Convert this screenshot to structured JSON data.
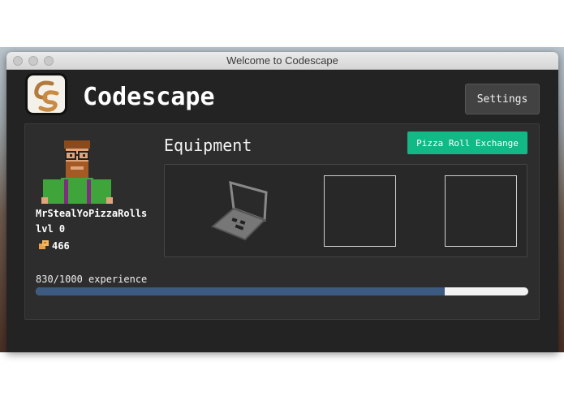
{
  "window": {
    "title": "Welcome to Codescape"
  },
  "header": {
    "app_name": "Codescape",
    "settings_label": "Settings"
  },
  "player": {
    "username": "MrStealYoPizzaRolls",
    "level_text": "lvl 0",
    "pizza_rolls": "466"
  },
  "equipment": {
    "title": "Equipment",
    "exchange_label": "Pizza Roll Exchange",
    "slots": [
      "laptop",
      "empty",
      "empty"
    ]
  },
  "experience": {
    "label": "830/1000 experience",
    "current": 830,
    "max": 1000
  },
  "colors": {
    "accent": "#12b886",
    "xp_fill": "#3d5a80",
    "window_bg": "#232323"
  },
  "icons": [
    "logo-icon",
    "avatar-icon",
    "pizza-roll-icon",
    "laptop-icon"
  ]
}
